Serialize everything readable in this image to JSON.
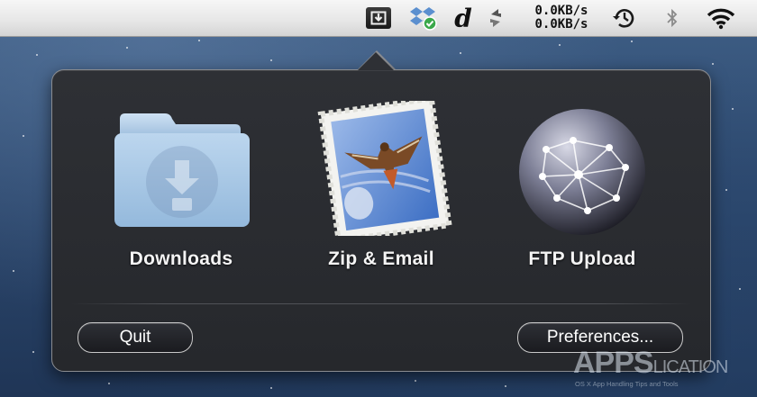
{
  "menubar": {
    "net_up": "0.0KB/s",
    "net_down": "0.0KB/s",
    "d_label": "d",
    "icons": [
      "download-box-icon",
      "dropbox-sync-icon",
      "d-app-icon",
      "sync-arrows-icon",
      "time-machine-icon",
      "bluetooth-icon",
      "wifi-icon"
    ]
  },
  "popover": {
    "actions": [
      {
        "label": "Downloads",
        "icon": "downloads-folder-icon"
      },
      {
        "label": "Zip & Email",
        "icon": "mail-stamp-icon"
      },
      {
        "label": "FTP Upload",
        "icon": "network-globe-icon"
      }
    ],
    "quit_label": "Quit",
    "preferences_label": "Preferences..."
  },
  "watermark": {
    "logo": "APPS",
    "logo_tail": "LICATION",
    "tagline": "OS X App Handling Tips and Tools"
  },
  "colors": {
    "popover_bg": "#2a2c30",
    "menubar_bg": "#e6e6e6",
    "folder_blue": "#a9c7e4"
  }
}
